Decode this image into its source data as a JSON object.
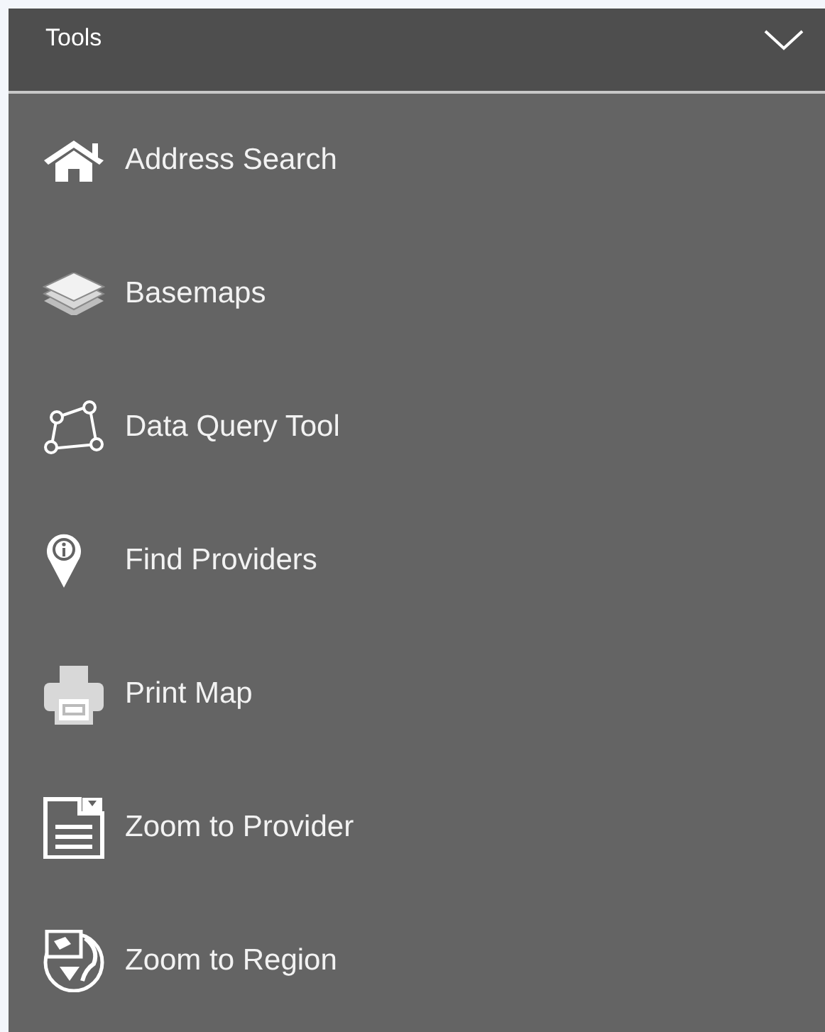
{
  "header": {
    "title": "Tools",
    "expanded": true
  },
  "items": [
    {
      "label": "Address Search"
    },
    {
      "label": "Basemaps"
    },
    {
      "label": "Data Query Tool"
    },
    {
      "label": "Find Providers"
    },
    {
      "label": "Print Map"
    },
    {
      "label": "Zoom to Provider"
    },
    {
      "label": "Zoom to Region"
    }
  ]
}
